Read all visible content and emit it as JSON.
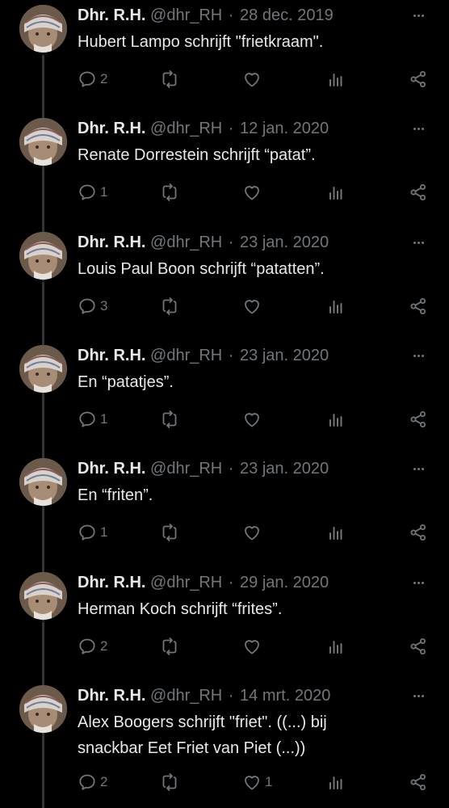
{
  "author": {
    "name": "Dhr. R.H.",
    "handle": "@dhr_RH",
    "separator": "·"
  },
  "icons": {
    "reply": "reply-icon",
    "retweet": "retweet-icon",
    "like": "heart-icon",
    "views": "views-icon",
    "share": "share-icon",
    "more": "more-icon"
  },
  "tweets": [
    {
      "date": "28 dec. 2019",
      "text": "Hubert Lampo schrijft \"frietkraam\".",
      "replies": "2",
      "retweets": "",
      "likes": ""
    },
    {
      "date": "12 jan. 2020",
      "text": "Renate Dorrestein schrijft “patat”.",
      "replies": "1",
      "retweets": "",
      "likes": ""
    },
    {
      "date": "23 jan. 2020",
      "text": "Louis Paul Boon schrijft “patatten”.",
      "replies": "3",
      "retweets": "",
      "likes": ""
    },
    {
      "date": "23 jan. 2020",
      "text": "En “patatjes”.",
      "replies": "1",
      "retweets": "",
      "likes": ""
    },
    {
      "date": "23 jan. 2020",
      "text": "En “friten”.",
      "replies": "1",
      "retweets": "",
      "likes": ""
    },
    {
      "date": "29 jan. 2020",
      "text": "Herman Koch schrijft “frites”.",
      "replies": "2",
      "retweets": "",
      "likes": ""
    },
    {
      "date": "14 mrt. 2020",
      "text": "Alex Boogers schrijft \"friet\". ((...) bij\nsnackbar Eet Friet van Piet (...))",
      "replies": "2",
      "retweets": "",
      "likes": "1"
    }
  ]
}
